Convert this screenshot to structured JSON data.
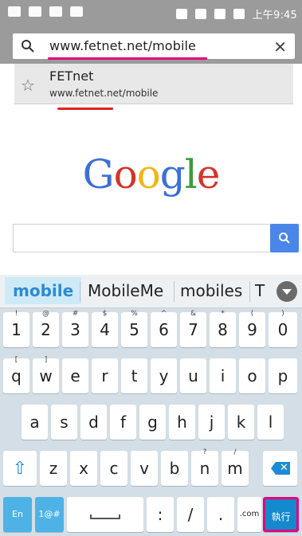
{
  "status_bar": {
    "time": "上午9:45"
  },
  "address_bar": {
    "url": "www.fetnet.net/mobile",
    "clear_icon": "close-icon"
  },
  "suggestion": {
    "title": "FETnet",
    "url": "www.fetnet.net/mobile",
    "icon": "star-icon"
  },
  "google_logo": {
    "letters": [
      "G",
      "o",
      "o",
      "g",
      "l",
      "e"
    ],
    "colors": [
      "#3c6fd6",
      "#d4342a",
      "#f2b512",
      "#3c6fd6",
      "#3d9b3b",
      "#d4342a"
    ]
  },
  "google_search": {
    "placeholder": "",
    "button_icon": "search-icon"
  },
  "keyboard": {
    "candidates": [
      "mobile",
      "MobileMe",
      "mobiles",
      "T"
    ],
    "row1": [
      {
        "key": "1",
        "alt": "!"
      },
      {
        "key": "2",
        "alt": "@"
      },
      {
        "key": "3",
        "alt": "#"
      },
      {
        "key": "4",
        "alt": "$"
      },
      {
        "key": "5",
        "alt": "%"
      },
      {
        "key": "6",
        "alt": "^"
      },
      {
        "key": "7",
        "alt": "&"
      },
      {
        "key": "8",
        "alt": "*"
      },
      {
        "key": "9",
        "alt": "("
      },
      {
        "key": "0",
        "alt": ")"
      }
    ],
    "row2": [
      {
        "key": "q",
        "alt": "["
      },
      {
        "key": "w",
        "alt": "]"
      },
      {
        "key": "e",
        "alt": ""
      },
      {
        "key": "r",
        "alt": ""
      },
      {
        "key": "t",
        "alt": ""
      },
      {
        "key": "y",
        "alt": ""
      },
      {
        "key": "u",
        "alt": ""
      },
      {
        "key": "i",
        "alt": ""
      },
      {
        "key": "o",
        "alt": ""
      },
      {
        "key": "p",
        "alt": ""
      }
    ],
    "row3": [
      {
        "key": "a",
        "alt": ""
      },
      {
        "key": "s",
        "alt": ""
      },
      {
        "key": "d",
        "alt": ""
      },
      {
        "key": "f",
        "alt": ""
      },
      {
        "key": "g",
        "alt": ""
      },
      {
        "key": "h",
        "alt": ""
      },
      {
        "key": "j",
        "alt": ""
      },
      {
        "key": "k",
        "alt": ""
      },
      {
        "key": "l",
        "alt": ""
      }
    ],
    "row4": [
      {
        "key": "z",
        "alt": ""
      },
      {
        "key": "x",
        "alt": ""
      },
      {
        "key": "c",
        "alt": ""
      },
      {
        "key": "v",
        "alt": ""
      },
      {
        "key": "b",
        "alt": ""
      },
      {
        "key": "n",
        "alt": "?"
      },
      {
        "key": "m",
        "alt": "/"
      }
    ],
    "bottom": {
      "lang": "En",
      "symbols": "1@#",
      "colon": ":",
      "slash": "/",
      "dot": ".",
      "com": ".com",
      "enter": "執行"
    }
  }
}
